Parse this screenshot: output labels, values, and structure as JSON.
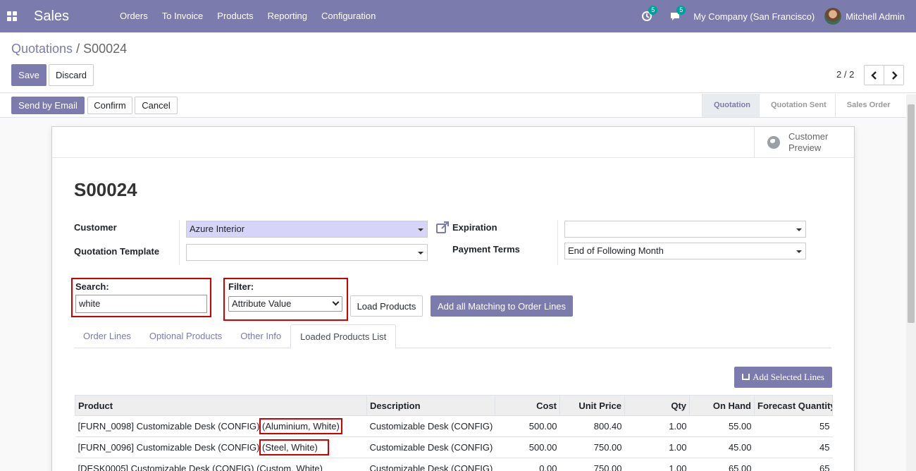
{
  "navbar": {
    "app_name": "Sales",
    "menu": [
      "Orders",
      "To Invoice",
      "Products",
      "Reporting",
      "Configuration"
    ],
    "activity_count": "5",
    "message_count": "5",
    "company": "My Company (San Francisco)",
    "user": "Mitchell Admin"
  },
  "breadcrumb": {
    "parent": "Quotations",
    "separator": "/",
    "current": "S00024"
  },
  "control": {
    "save_label": "Save",
    "discard_label": "Discard",
    "pager": "2 / 2"
  },
  "statusbar": {
    "send_label": "Send by Email",
    "confirm_label": "Confirm",
    "cancel_label": "Cancel",
    "stages": [
      "Quotation",
      "Quotation Sent",
      "Sales Order"
    ],
    "active_stage": "Quotation"
  },
  "preview": {
    "line1": "Customer",
    "line2": "Preview"
  },
  "form": {
    "title": "S00024",
    "customer_label": "Customer",
    "customer_value": "Azure Interior",
    "template_label": "Quotation Template",
    "template_value": "",
    "expiration_label": "Expiration",
    "expiration_value": "",
    "payment_terms_label": "Payment Terms",
    "payment_terms_value": "End of Following Month"
  },
  "search": {
    "label": "Search:",
    "value": "white"
  },
  "filter": {
    "label": "Filter:",
    "value": "Attribute Value"
  },
  "actions": {
    "load_label": "Load Products",
    "add_all_label": "Add all Matching to Order Lines",
    "add_selected_label": "Add Selected Lines"
  },
  "tabs": [
    "Order Lines",
    "Optional Products",
    "Other Info",
    "Loaded Products List"
  ],
  "active_tab": "Loaded Products List",
  "table": {
    "columns": [
      "Product",
      "Description",
      "Cost",
      "Unit Price",
      "Qty",
      "On Hand",
      "Forecast Quantity"
    ],
    "rows": [
      {
        "product": "[FURN_0098] Customizable Desk (CONFIG)",
        "variant": "(Aluminium, White)",
        "description": "Customizable Desk (CONFIG)",
        "cost": "500.00",
        "unit_price": "800.40",
        "qty": "1.00",
        "on_hand": "55.00",
        "forecast": "55"
      },
      {
        "product": "[FURN_0096] Customizable Desk (CONFIG)",
        "variant": "(Steel, White)",
        "description": "Customizable Desk (CONFIG)",
        "cost": "500.00",
        "unit_price": "750.00",
        "qty": "1.00",
        "on_hand": "45.00",
        "forecast": "45"
      },
      {
        "product": "[DESK0005] Customizable Desk (CONFIG)",
        "variant": "(Custom, White)",
        "description": "Customizable Desk (CONFIG)",
        "cost": "0.00",
        "unit_price": "750.00",
        "qty": "1.00",
        "on_hand": "65.00",
        "forecast": "65"
      }
    ]
  },
  "colors": {
    "brand": "#7c7bad",
    "highlight": "#d00000",
    "badge": "#00a09d"
  }
}
